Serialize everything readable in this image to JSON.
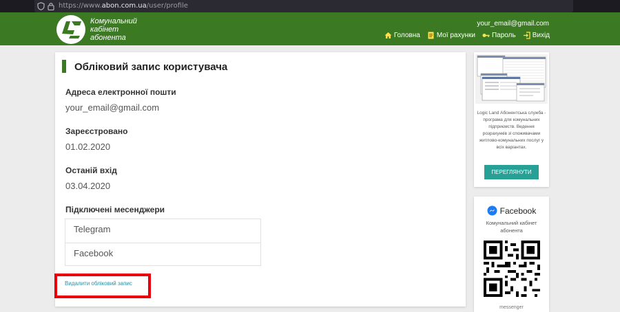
{
  "browser": {
    "url_prefix": "https://www.",
    "url_domain": "abon.com.ua",
    "url_path": "/user/profile"
  },
  "header": {
    "logo_line1": "Комунальний",
    "logo_line2": "кабінет",
    "logo_line3": "абонента",
    "user_email": "your_email@gmail.com",
    "nav": {
      "home": "Головна",
      "accounts": "Мої рахунки",
      "password": "Пароль",
      "logout": "Вихід"
    }
  },
  "profile": {
    "title": "Обліковий запис користувача",
    "email_label": "Адреса електронної пошти",
    "email_value": "your_email@gmail.com",
    "registered_label": "Зареєстровано",
    "registered_value": "01.02.2020",
    "last_login_label": "Останій вхід",
    "last_login_value": "03.04.2020",
    "messengers_label": "Підключені месенджери",
    "messengers": [
      "Telegram",
      "Facebook"
    ],
    "delete_link": "Видалити обліковий запис"
  },
  "promo": {
    "text": "Logic Land Абонентська служба - програма для комунальних підприємств. Ведення розрахунків зі споживачами житлово-комунальних послуг у всіх варіантах.",
    "button": "ПЕРЕГЛЯНУТИ"
  },
  "facebook_card": {
    "title": "Facebook",
    "subtitle": "Комунальний кабінет абонента",
    "footer": "messenger"
  },
  "colors": {
    "header_green": "#3b7a23",
    "accent_teal": "#27a096",
    "link": "#2b8ea5",
    "highlight_red": "#e8000b"
  }
}
